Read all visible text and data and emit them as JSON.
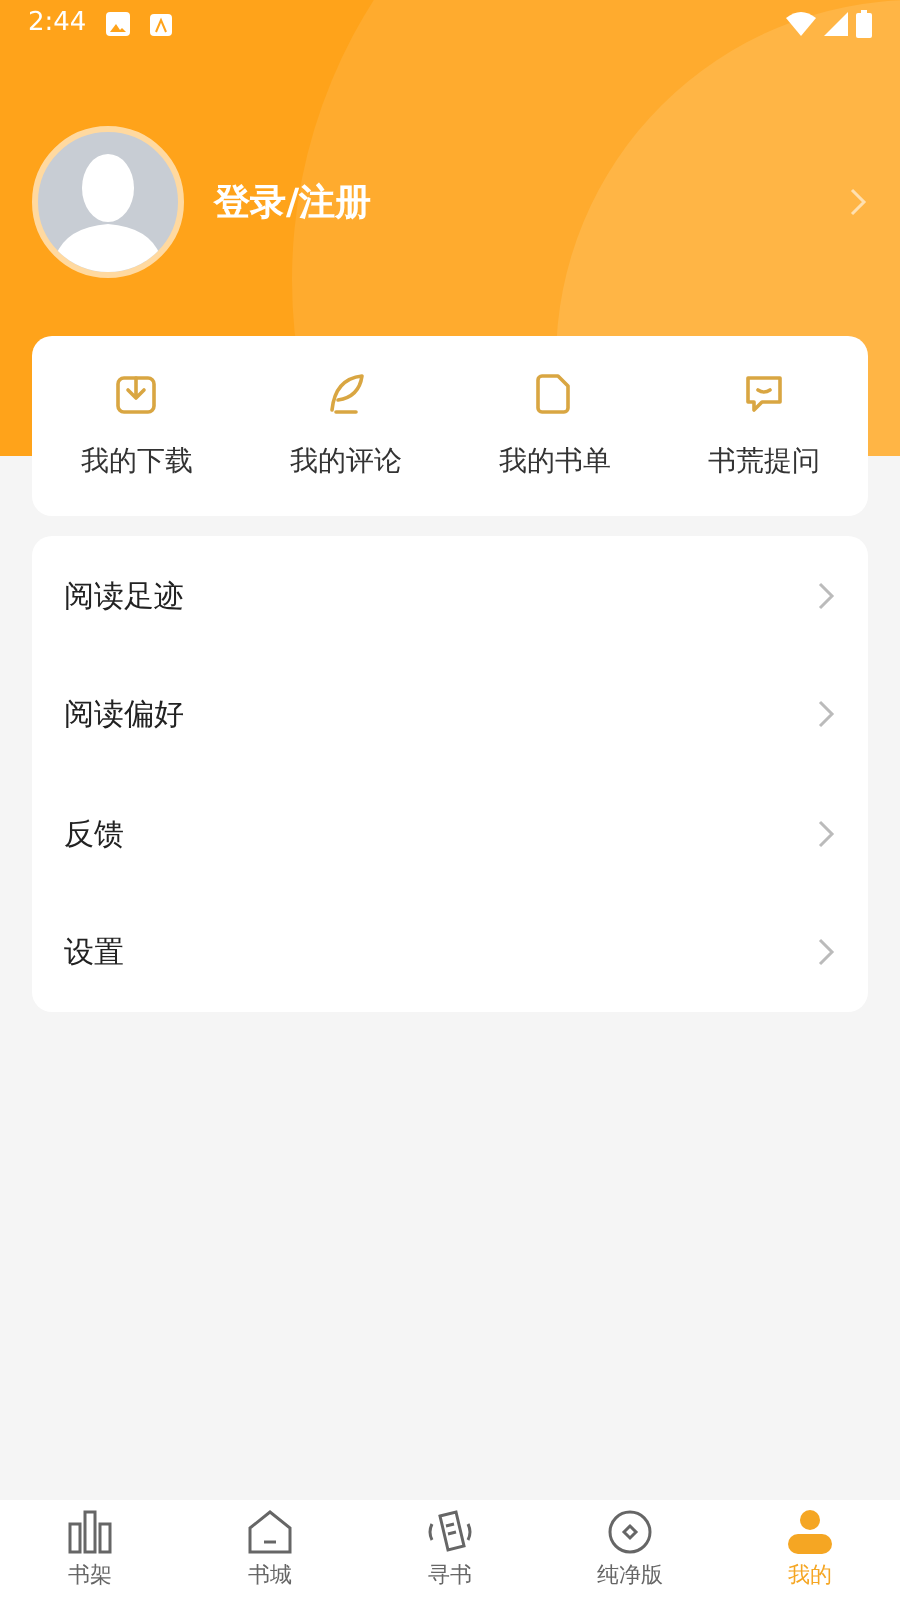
{
  "status_bar": {
    "time": "2:44"
  },
  "profile": {
    "login_label": "登录/注册"
  },
  "quick_actions": [
    {
      "kind": "download",
      "label": "我的下载"
    },
    {
      "kind": "comment",
      "label": "我的评论"
    },
    {
      "kind": "booklist",
      "label": "我的书单"
    },
    {
      "kind": "ask",
      "label": "书荒提问"
    }
  ],
  "menu_items": [
    {
      "label": "阅读足迹"
    },
    {
      "label": "阅读偏好"
    },
    {
      "label": "反馈"
    },
    {
      "label": "设置"
    }
  ],
  "bottom_nav": [
    {
      "kind": "shelf",
      "label": "书架",
      "selected": false
    },
    {
      "kind": "store",
      "label": "书城",
      "selected": false
    },
    {
      "kind": "find",
      "label": "寻书",
      "selected": false
    },
    {
      "kind": "pure",
      "label": "纯净版",
      "selected": false
    },
    {
      "kind": "me",
      "label": "我的",
      "selected": true
    }
  ]
}
